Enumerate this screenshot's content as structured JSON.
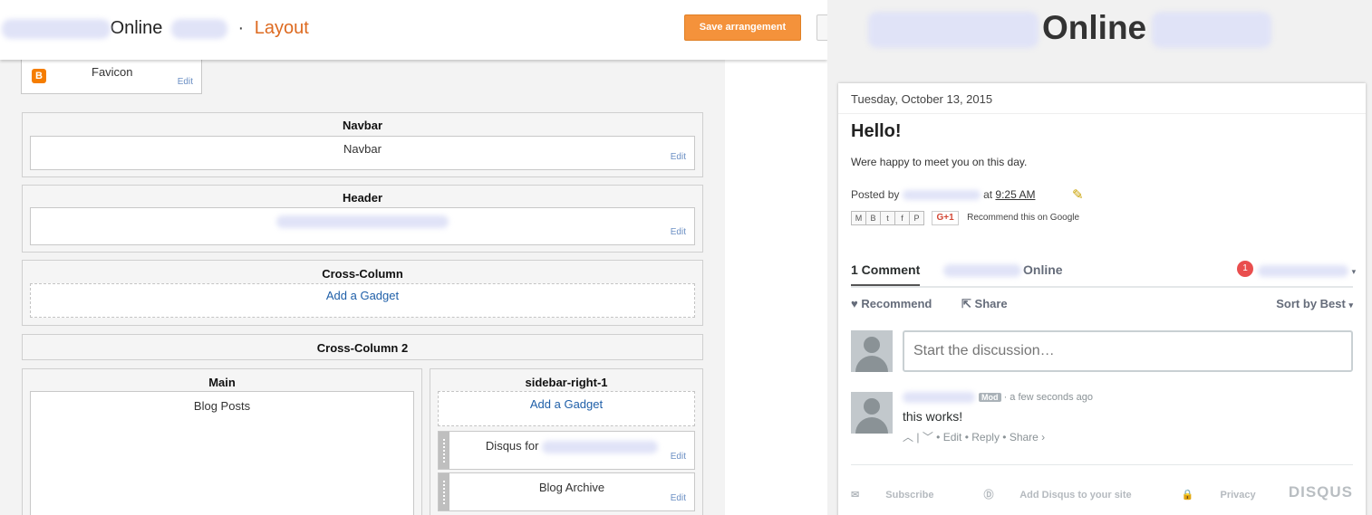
{
  "editor": {
    "title_suffix": "Online",
    "separator": "·",
    "page_name": "Layout",
    "save_label": "Save arrangement"
  },
  "layout": {
    "favicon": {
      "label": "Favicon",
      "edit": "Edit"
    },
    "navbar": {
      "title": "Navbar",
      "gadget": "Navbar",
      "edit": "Edit"
    },
    "header": {
      "title": "Header",
      "edit": "Edit"
    },
    "cross_column": {
      "title": "Cross-Column",
      "add": "Add a Gadget"
    },
    "cross_column_2": {
      "title": "Cross-Column 2"
    },
    "main": {
      "title": "Main",
      "gadget": "Blog Posts"
    },
    "sidebar": {
      "title": "sidebar-right-1",
      "add": "Add a Gadget",
      "disqus": "Disqus for",
      "archive": "Blog Archive",
      "edit": "Edit"
    }
  },
  "blog": {
    "title": "Online",
    "date": "Tuesday, October 13, 2015",
    "post_title": "Hello!",
    "post_body": "Were happy to meet you on this day.",
    "posted_by": "Posted by",
    "at": "at",
    "time": "9:25 AM",
    "gplus": "G+1",
    "recommend_google": "Recommend this on Google"
  },
  "disqus": {
    "comment_count": "1 Comment",
    "site_name": "Online",
    "notifications": "1",
    "recommend": "Recommend",
    "share": "Share",
    "sort": "Sort by Best",
    "input_placeholder": "Start the discussion…",
    "mod_badge": "Mod",
    "comment_time": "a few seconds ago",
    "comment_text": "this works!",
    "comment_edit": "Edit",
    "comment_reply": "Reply",
    "comment_share": "Share ›",
    "subscribe": "Subscribe",
    "add_disqus": "Add Disqus to your site",
    "privacy": "Privacy",
    "logo": "DISQUS"
  },
  "colors": {
    "accent": "#f4923b",
    "layout_orange": "#dd6a20",
    "link_blue": "#1f5fa8",
    "disqus_badge": "#e94e4e"
  }
}
